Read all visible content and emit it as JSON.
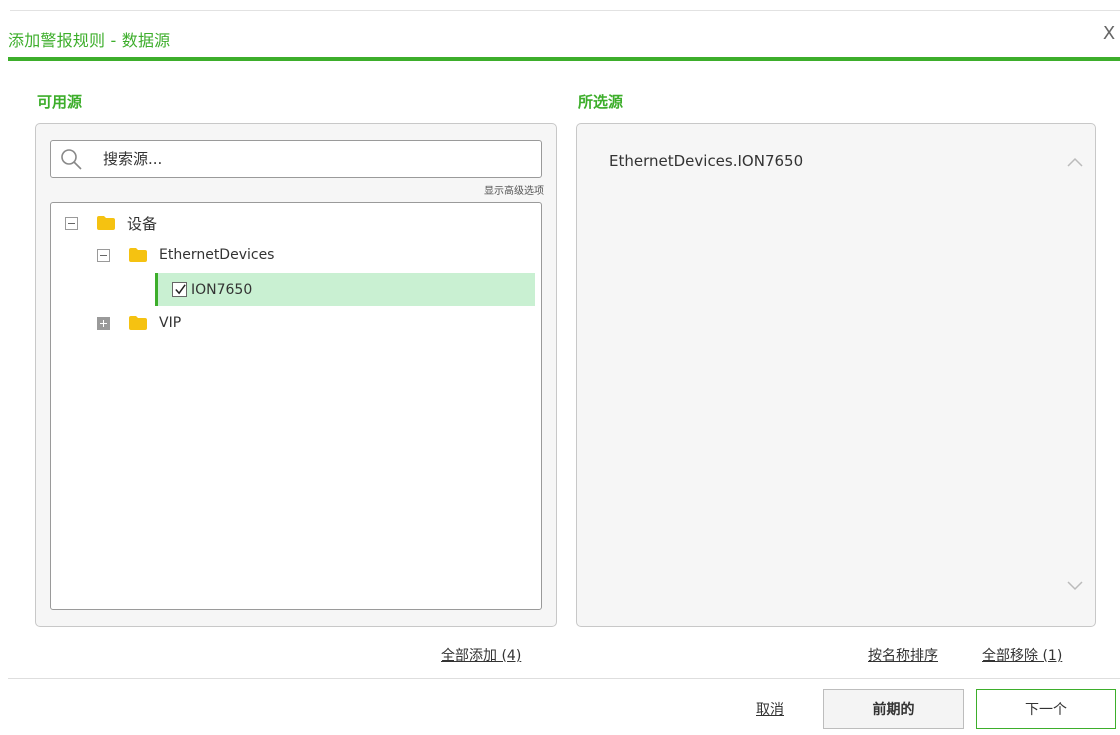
{
  "dialog": {
    "title": "添加警报规则 - 数据源",
    "close_label": "X"
  },
  "available": {
    "heading": "可用源",
    "search_placeholder": "搜索源...",
    "advanced_link": "显示高级选项",
    "tree": {
      "root": {
        "label": "设备",
        "expanded": true
      },
      "ethernet": {
        "label": "EthernetDevices",
        "expanded": true
      },
      "ion": {
        "label": "ION7650",
        "checked": true,
        "selected": true
      },
      "vip": {
        "label": "VIP",
        "expanded": false
      }
    },
    "add_all": "全部添加 (4)"
  },
  "selected": {
    "heading": "所选源",
    "items": [
      "EthernetDevices.ION7650"
    ],
    "sort_by_name": "按名称排序",
    "remove_all": "全部移除 (1)"
  },
  "footer": {
    "cancel": "取消",
    "previous": "前期的",
    "next": "下一个"
  },
  "colors": {
    "accent": "#3dae2b",
    "selection_bg": "#c9f0d2",
    "folder": "#f5c211"
  },
  "icons": {
    "search": "search-icon",
    "folder": "folder-icon",
    "close": "close-icon",
    "check": "check-icon",
    "scroll_up": "chevron-up-icon",
    "scroll_down": "chevron-down-icon"
  }
}
